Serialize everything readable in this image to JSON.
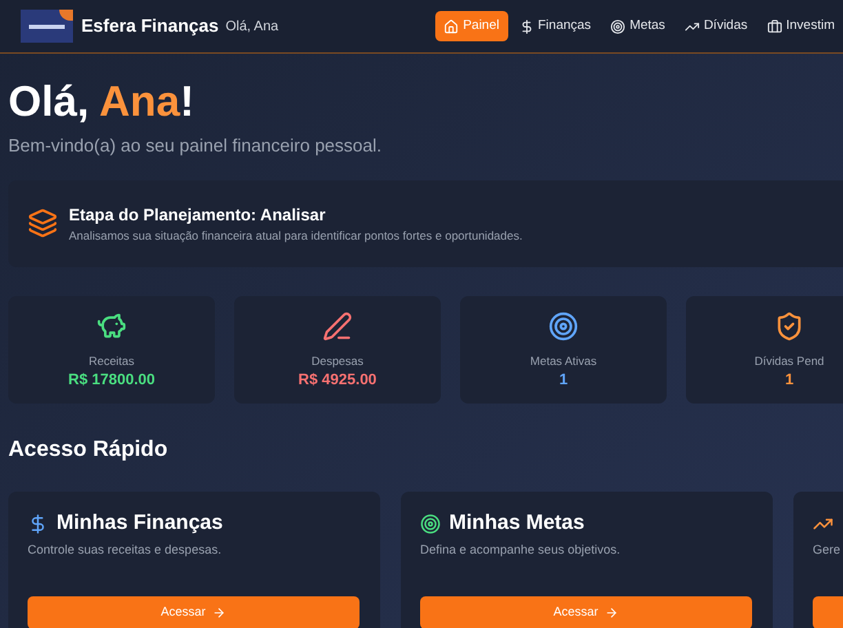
{
  "header": {
    "brand": "Esfera Finanças",
    "greeting": "Olá, Ana"
  },
  "nav": [
    {
      "label": "Painel",
      "kind": "home",
      "selected": true
    },
    {
      "label": "Finanças",
      "kind": "dollar",
      "selected": false
    },
    {
      "label": "Metas",
      "kind": "target",
      "selected": false
    },
    {
      "label": "Dívidas",
      "kind": "trend",
      "selected": false
    },
    {
      "label": "Investim",
      "kind": "briefcase",
      "selected": false
    }
  ],
  "welcome": {
    "hello": "Olá, ",
    "name": "Ana",
    "mark": "!",
    "subtitle": "Bem-vindo(a) ao seu painel financeiro pessoal."
  },
  "stage": {
    "title": "Etapa do Planejamento: Analisar",
    "description": "Analisamos sua situação financeira atual para identificar pontos fortes e oportunidades."
  },
  "stats": [
    {
      "label": "Receitas",
      "value": "R$ 17800.00",
      "kind": "piggy",
      "color": "#4ade80"
    },
    {
      "label": "Despesas",
      "value": "R$ 4925.00",
      "kind": "pen",
      "color": "#f87171"
    },
    {
      "label": "Metas Ativas",
      "value": "1",
      "kind": "target",
      "color": "#60a5fa"
    },
    {
      "label": "Dívidas Pend",
      "value": "1",
      "kind": "shield",
      "color": "#fb923c"
    }
  ],
  "quick_access": {
    "title": "Acesso Rápido",
    "cards": [
      {
        "title": "Minhas Finanças",
        "description": "Controle suas receitas e despesas.",
        "button": "Acessar",
        "kind": "dollar",
        "color": "#60a5fa"
      },
      {
        "title": "Minhas Metas",
        "description": "Defina e acompanhe seus objetivos.",
        "button": "Acessar",
        "kind": "target",
        "color": "#4ade80"
      },
      {
        "description": "Gere",
        "kind": "trend",
        "color": "#fb923c"
      }
    ]
  }
}
